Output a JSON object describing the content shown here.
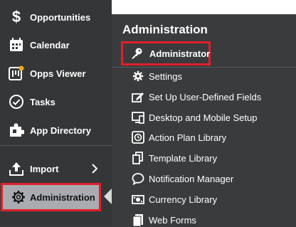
{
  "sidebar": {
    "items": [
      {
        "label": "Opportunities",
        "icon": "dollar-icon"
      },
      {
        "label": "Calendar",
        "icon": "calendar-icon"
      },
      {
        "label": "Opps Viewer",
        "icon": "opps-viewer-icon"
      },
      {
        "label": "Tasks",
        "icon": "check-circle-icon"
      },
      {
        "label": "App Directory",
        "icon": "puzzle-icon"
      },
      {
        "label": "Import",
        "icon": "upload-icon"
      },
      {
        "label": "Administration",
        "icon": "gear-icon"
      }
    ]
  },
  "flyout": {
    "title": "Administration",
    "highlighted": {
      "label": "Administrator",
      "icon": "key-icon"
    },
    "items": [
      {
        "label": "Settings",
        "icon": "gear-icon"
      },
      {
        "label": "Set Up User-Defined Fields",
        "icon": "edit-fields-icon"
      },
      {
        "label": "Desktop and Mobile Setup",
        "icon": "devices-icon"
      },
      {
        "label": "Action Plan Library",
        "icon": "clock-icon"
      },
      {
        "label": "Template Library",
        "icon": "copy-icon"
      },
      {
        "label": "Notification Manager",
        "icon": "chat-bubble-icon"
      },
      {
        "label": "Currency Library",
        "icon": "currency-icon"
      },
      {
        "label": "Web Forms",
        "icon": "web-forms-icon"
      }
    ]
  },
  "colors": {
    "highlight_border": "#e0202a",
    "sidebar_bg": "#353638",
    "selected_bg": "#a9abb0"
  }
}
